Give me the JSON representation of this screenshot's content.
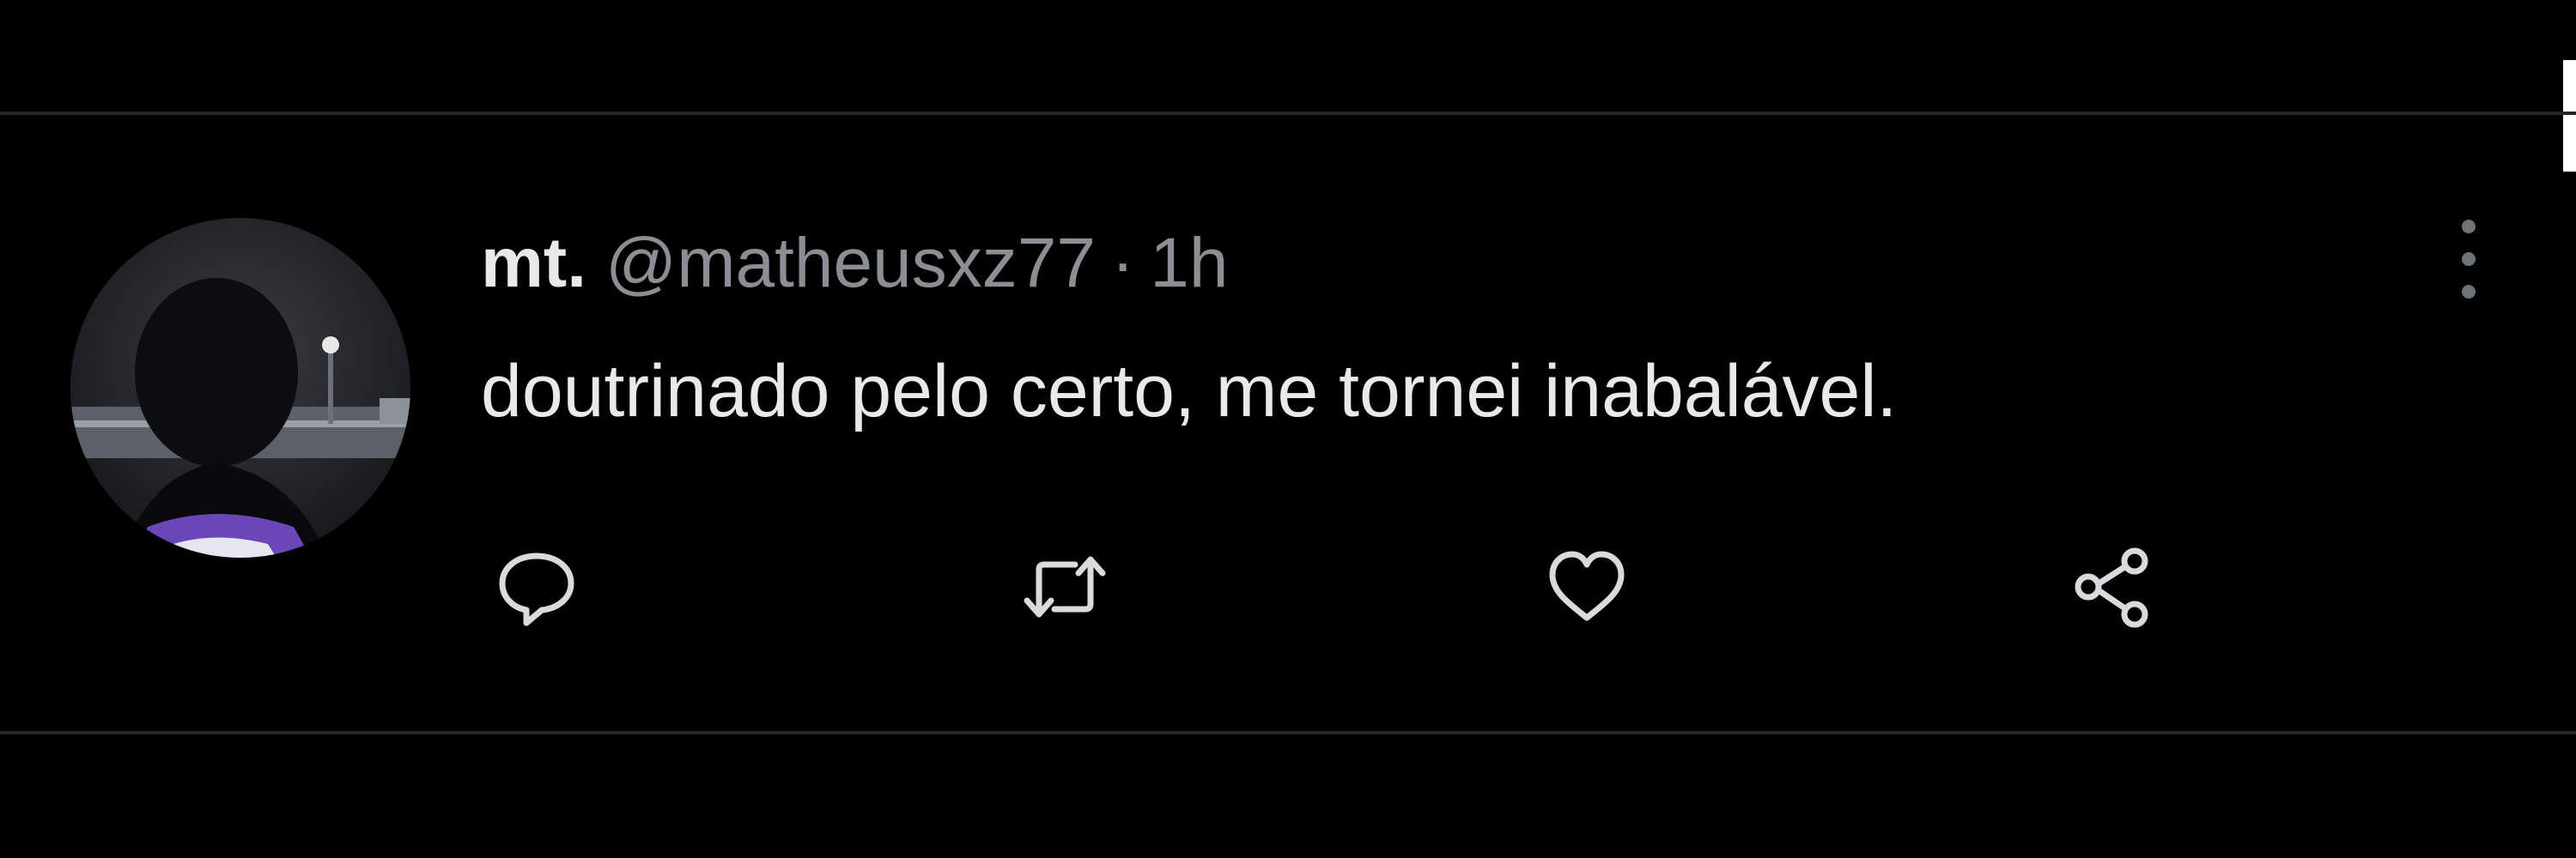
{
  "tweet": {
    "display_name": "mt.",
    "handle": "@matheusxz77",
    "separator": "·",
    "timestamp": "1h",
    "text": "doutrinado pelo certo, me tornei inabalável."
  },
  "icons": {
    "avatar": "user-avatar-photo",
    "more": "more-vertical-icon",
    "reply": "reply-icon",
    "retweet": "retweet-icon",
    "like": "heart-icon",
    "share": "share-icon"
  },
  "colors": {
    "background": "#000000",
    "primary_text": "#e7e9ea",
    "secondary_text": "#8b8f94",
    "divider": "#23272a"
  }
}
